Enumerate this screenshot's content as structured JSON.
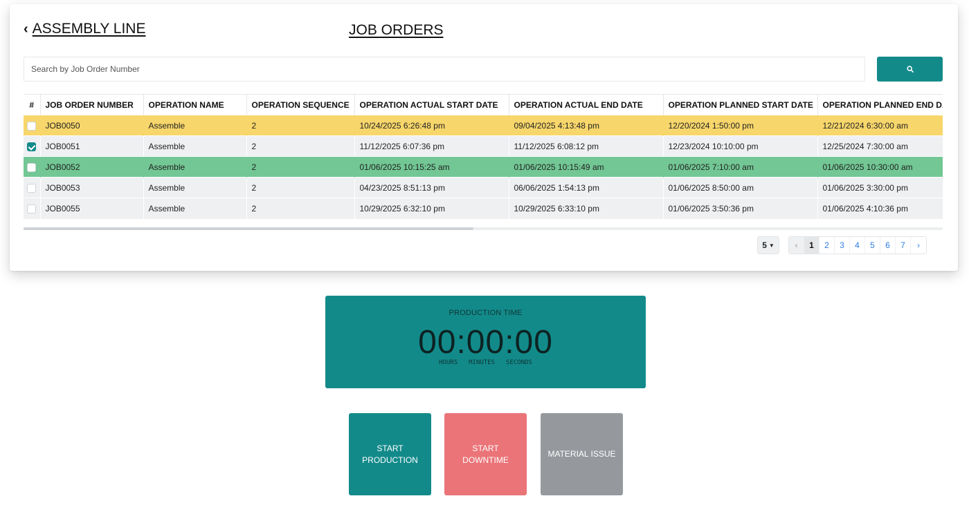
{
  "header": {
    "back_label": "ASSEMBLY LINE",
    "back_icon": "chevron-left-icon",
    "title": "JOB ORDERS"
  },
  "search": {
    "placeholder": "Search by Job Order Number",
    "value": "",
    "button_icon": "search-icon"
  },
  "table": {
    "columns": [
      "#",
      "JOB ORDER NUMBER",
      "OPERATION NAME",
      "OPERATION SEQUENCE",
      "OPERATION ACTUAL START DATE",
      "OPERATION ACTUAL END DATE",
      "OPERATION PLANNED START DATE",
      "OPERATION PLANNED END DATE"
    ],
    "rows": [
      {
        "checked": false,
        "highlight": "yellow",
        "job": "JOB0050",
        "op": "Assemble",
        "seq": "2",
        "actual_start": "10/24/2025 6:26:48 pm",
        "actual_end": "09/04/2025 4:13:48 pm",
        "planned_start": "12/20/2024 1:50:00 pm",
        "planned_end": "12/21/2024 6:30:00 am"
      },
      {
        "checked": true,
        "highlight": "none",
        "job": "JOB0051",
        "op": "Assemble",
        "seq": "2",
        "actual_start": "11/12/2025 6:07:36 pm",
        "actual_end": "11/12/2025 6:08:12 pm",
        "planned_start": "12/23/2024 10:10:00 pm",
        "planned_end": "12/25/2024 7:30:00 am"
      },
      {
        "checked": false,
        "highlight": "green",
        "job": "JOB0052",
        "op": "Assemble",
        "seq": "2",
        "actual_start": "01/06/2025 10:15:25 am",
        "actual_end": "01/06/2025 10:15:49 am",
        "planned_start": "01/06/2025 7:10:00 am",
        "planned_end": "01/06/2025 10:30:00 am"
      },
      {
        "checked": false,
        "highlight": "none",
        "job": "JOB0053",
        "op": "Assemble",
        "seq": "2",
        "actual_start": "04/23/2025 8:51:13 pm",
        "actual_end": "06/06/2025 1:54:13 pm",
        "planned_start": "01/06/2025 8:50:00 am",
        "planned_end": "01/06/2025 3:30:00 pm"
      },
      {
        "checked": false,
        "highlight": "none",
        "job": "JOB0055",
        "op": "Assemble",
        "seq": "2",
        "actual_start": "10/29/2025 6:32:10 pm",
        "actual_end": "10/29/2025 6:33:10 pm",
        "planned_start": "01/06/2025 3:50:36 pm",
        "planned_end": "01/06/2025 4:10:36 pm"
      }
    ]
  },
  "pagination": {
    "page_size": "5",
    "prev": "‹",
    "next": "›",
    "pages": [
      "1",
      "2",
      "3",
      "4",
      "5",
      "6",
      "7"
    ],
    "current": "1"
  },
  "timer": {
    "label": "PRODUCTION TIME",
    "value": "00:00:00",
    "units": [
      "HOURS",
      "MINUTES",
      "SECONDS"
    ]
  },
  "actions": {
    "start_production": "START PRODUCTION",
    "start_downtime": "START DOWNTIME",
    "material_issue": "MATERIAL ISSUE"
  },
  "colors": {
    "accent": "#138a8a",
    "row_yellow": "#f7d66b",
    "row_green": "#72c794",
    "downtime": "#ea7478",
    "material": "#95999d"
  }
}
